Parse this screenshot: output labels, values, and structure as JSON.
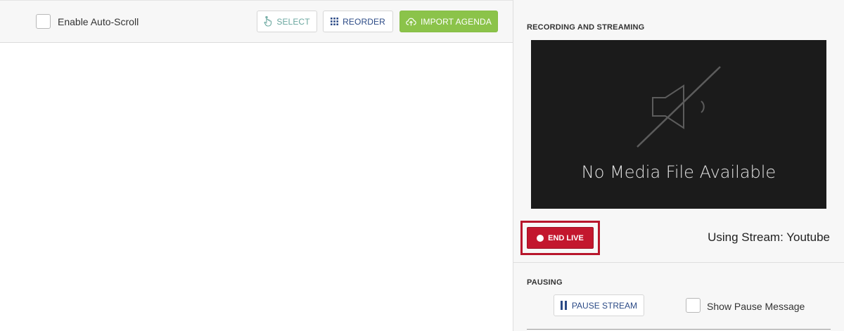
{
  "toolbar": {
    "auto_scroll_label": "Enable Auto-Scroll",
    "select_label": "SELECT",
    "reorder_label": "REORDER",
    "import_label": "IMPORT AGENDA"
  },
  "recording": {
    "title": "RECORDING AND STREAMING",
    "no_media_text": "No Media File Available",
    "end_live_label": "END LIVE",
    "stream_status": "Using Stream: Youtube"
  },
  "pausing": {
    "title": "PAUSING",
    "pause_button_label": "PAUSE STREAM",
    "show_message_label": "Show Pause Message"
  },
  "colors": {
    "import_green": "#8bc34a",
    "end_live_red": "#c3172e",
    "reorder_blue": "#2b4a86",
    "select_teal": "#6aa79f"
  },
  "icons": {
    "select": "pointer-hand-icon",
    "reorder": "grid-dots-icon",
    "import": "cloud-upload-icon",
    "media": "muted-speaker-icon",
    "end_live": "record-dot-icon",
    "pause": "pause-icon"
  }
}
